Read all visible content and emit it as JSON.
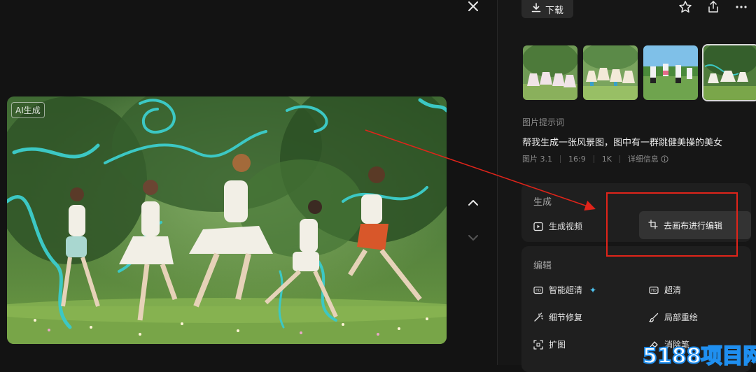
{
  "viewer": {
    "close_icon": "close-icon",
    "nav_up_icon": "chevron-up-icon",
    "nav_down_icon": "chevron-down-icon",
    "image_badge": "AI生成"
  },
  "toolbar": {
    "download_label": "下载",
    "download_icon": "download-icon",
    "favorite_icon": "star-icon",
    "share_icon": "share-icon",
    "more_icon": "more-icon"
  },
  "thumbnails": [
    {
      "label": "",
      "active": false
    },
    {
      "label": "",
      "active": false
    },
    {
      "label": "",
      "active": false
    },
    {
      "label": "",
      "active": true
    }
  ],
  "prompt": {
    "label": "图片提示词",
    "text": "帮我生成一张风景图，图中有一群跳健美操的美女"
  },
  "meta": {
    "model": "图片 3.1",
    "ratio": "16:9",
    "resolution": "1K",
    "details_label": "详细信息",
    "info_icon": "info-icon"
  },
  "generate": {
    "title": "生成",
    "video_label": "生成视频",
    "canvas_label": "去画布进行编辑"
  },
  "edit": {
    "title": "编辑",
    "items": {
      "smart_hd": "智能超清",
      "hd": "超清",
      "detail_fix": "细节修复",
      "local_redraw": "局部重绘",
      "expand": "扩图",
      "eraser": "消除笔"
    }
  },
  "watermark": {
    "text": "5188项目网"
  },
  "colors": {
    "background": "#131313",
    "panel": "#161616",
    "card": "#1f1f1f",
    "annotation_red": "#e0241a",
    "sparkle_blue": "#4ec3f0"
  }
}
